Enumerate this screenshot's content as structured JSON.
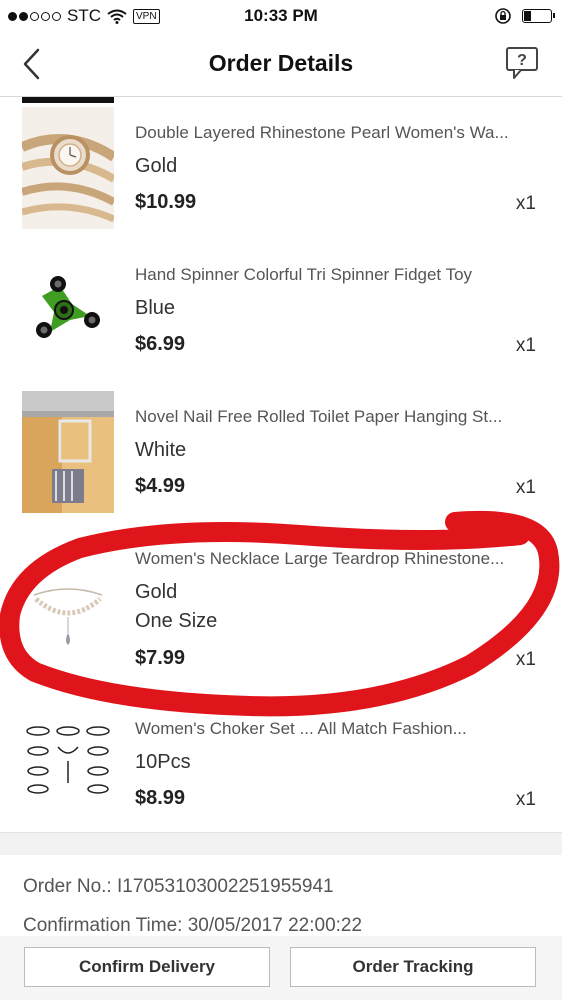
{
  "status_bar": {
    "carrier": "STC",
    "vpn": "VPN",
    "time": "10:33 PM"
  },
  "header": {
    "title": "Order Details"
  },
  "items": [
    {
      "name": "Double Layered Rhinestone Pearl Women's Wa...",
      "variant": "Gold",
      "price": "$10.99",
      "qty": "x1",
      "thumb_icon": "watch-image"
    },
    {
      "name": "Hand Spinner Colorful Tri Spinner Fidget Toy",
      "variant": "Blue",
      "price": "$6.99",
      "qty": "x1",
      "thumb_icon": "fidget-spinner-image"
    },
    {
      "name": "Novel Nail Free Rolled Toilet Paper Hanging St...",
      "variant": "White",
      "price": "$4.99",
      "qty": "x1",
      "thumb_icon": "toilet-paper-holder-image"
    },
    {
      "name": "Women's Necklace Large Teardrop Rhinestone...",
      "variant": "Gold",
      "variant2": "One Size",
      "price": "$7.99",
      "qty": "x1",
      "thumb_icon": "necklace-image"
    },
    {
      "name": "Women's Choker Set ... All Match Fashion...",
      "variant": "10Pcs",
      "price": "$8.99",
      "qty": "x1",
      "thumb_icon": "choker-set-image"
    }
  ],
  "order_info": {
    "order_no": "Order No.: I17053103002251955941",
    "confirmation_time": "Confirmation Time: 30/05/2017 22:00:22"
  },
  "actions": {
    "confirm_delivery": "Confirm Delivery",
    "order_tracking": "Order Tracking"
  },
  "colors": {
    "annotation_red": "#e0151b"
  }
}
